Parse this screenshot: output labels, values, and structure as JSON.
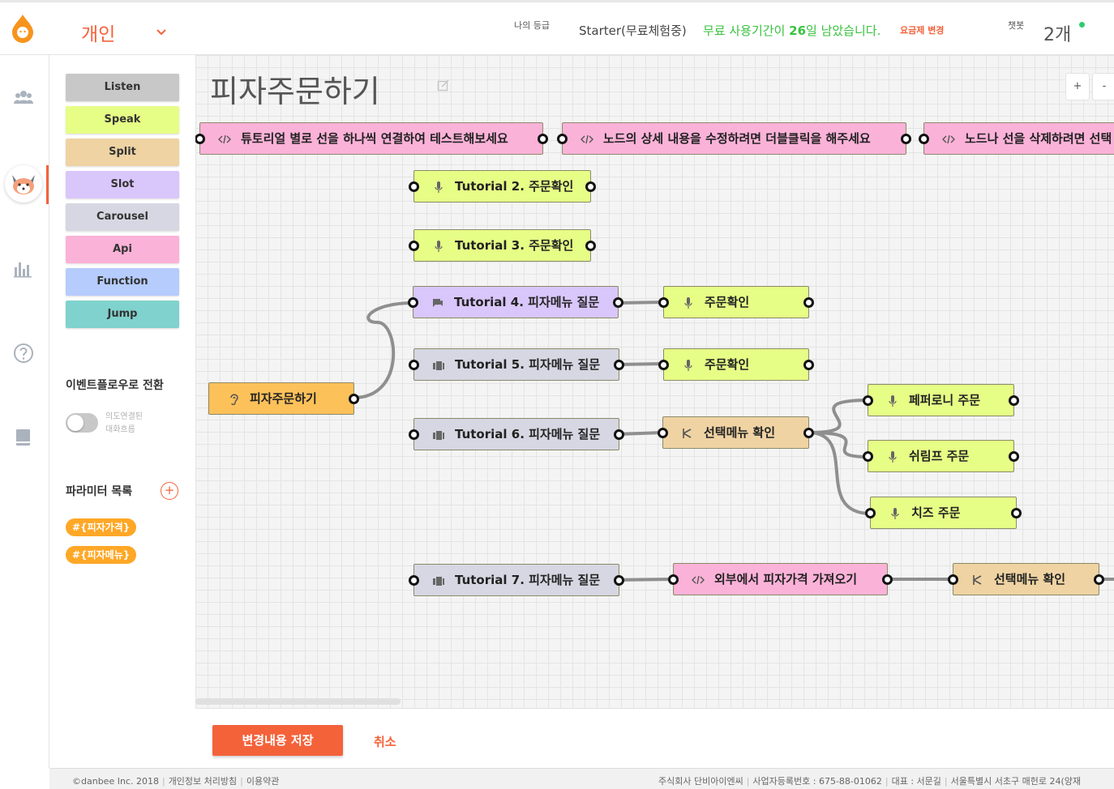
{
  "header": {
    "workspace": "개인",
    "grade_label": "나의 등급",
    "plan": "Starter(무료체험중)",
    "trial_prefix": "무료 사용기간이 ",
    "trial_days": "26",
    "trial_suffix": "일 남았습니다.",
    "change_plan": "요금제 변경",
    "chatbot_label": "챗봇",
    "chatbot_count": "2개"
  },
  "rail": {
    "icons": [
      "users-icon",
      "bot-avatar",
      "chart-icon",
      "help-icon",
      "book-icon"
    ]
  },
  "palette": {
    "buttons": [
      {
        "label": "Listen",
        "color": "#c8c8c8"
      },
      {
        "label": "Speak",
        "color": "#e6fd86"
      },
      {
        "label": "Split",
        "color": "#efd3a3"
      },
      {
        "label": "Slot",
        "color": "#d9c6fb"
      },
      {
        "label": "Carousel",
        "color": "#d6d7e2"
      },
      {
        "label": "Api",
        "color": "#fbb2d8"
      },
      {
        "label": "Function",
        "color": "#b5ccfd"
      },
      {
        "label": "Jump",
        "color": "#7fd2cd"
      }
    ],
    "event_flow_title": "이벤트플로우로 전환",
    "toggle_label_line1": "의도연결된",
    "toggle_label_line2": "대화흐름",
    "params_title": "파라미터 목록",
    "add_param": "+",
    "params": [
      "#{피자가격}",
      "#{피자메뉴}"
    ]
  },
  "canvas": {
    "title": "피자주문하기",
    "zoom_in": "+",
    "zoom_out": "-",
    "nodes": [
      {
        "id": "n1",
        "label": "튜토리얼 별로 선을 하나씩 연결하여 테스트해보세요",
        "type": "api"
      },
      {
        "id": "n2",
        "label": "노드의 상세 내용을 수정하려면 더블클릭을 해주세요",
        "type": "api"
      },
      {
        "id": "n3",
        "label": "노드나 선을 삭제하려면 선택",
        "type": "api"
      },
      {
        "id": "n4",
        "label": "Tutorial 2. 주문확인",
        "type": "speak"
      },
      {
        "id": "n5",
        "label": "Tutorial 3. 주문확인",
        "type": "speak"
      },
      {
        "id": "n6",
        "label": "Tutorial 4. 피자메뉴 질문",
        "type": "slot"
      },
      {
        "id": "n7",
        "label": "주문확인",
        "type": "speak"
      },
      {
        "id": "n8",
        "label": "Tutorial 5. 피자메뉴 질문",
        "type": "carousel"
      },
      {
        "id": "n9",
        "label": "주문확인",
        "type": "speak"
      },
      {
        "id": "n10",
        "label": "피자주문하기",
        "type": "start"
      },
      {
        "id": "n11",
        "label": "Tutorial 6. 피자메뉴 질문",
        "type": "carousel"
      },
      {
        "id": "n12",
        "label": "선택메뉴 확인",
        "type": "split"
      },
      {
        "id": "n13",
        "label": "페퍼로니 주문",
        "type": "speak"
      },
      {
        "id": "n14",
        "label": "쉬림프 주문",
        "type": "speak"
      },
      {
        "id": "n15",
        "label": "치즈 주문",
        "type": "speak"
      },
      {
        "id": "n16",
        "label": "Tutorial 7. 피자메뉴 질문",
        "type": "carousel"
      },
      {
        "id": "n17",
        "label": "외부에서 피자가격 가져오기",
        "type": "api"
      },
      {
        "id": "n18",
        "label": "선택메뉴 확인",
        "type": "split"
      }
    ]
  },
  "actions": {
    "save": "변경내용 저장",
    "cancel": "취소"
  },
  "footer": {
    "copyright": "©danbee Inc. 2018",
    "privacy": "개인정보 처리방침",
    "terms": "이용약관",
    "company": "주식회사 단비아이엔씨",
    "biz_no": "사업자등록번호 : 675-88-01062",
    "ceo": "대표 : 서문길",
    "address": "서울특별시 서초구 매헌로 24(양재"
  },
  "colors": {
    "accent": "#f4623a",
    "trial_green": "#39c23f",
    "speak": "#e6fd86",
    "split": "#efd3a3",
    "slot": "#d9c6fb",
    "carousel": "#d6d7e2",
    "api": "#fbb2d8",
    "start": "#fdc15a",
    "param_chip": "#ffa726"
  }
}
